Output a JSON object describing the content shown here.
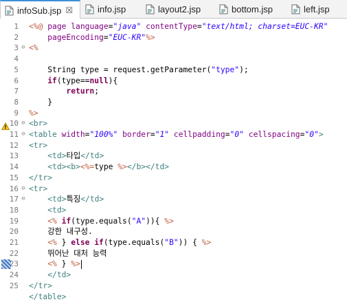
{
  "tabs": [
    {
      "label": "infoSub.jsp",
      "active": true,
      "close": "☒"
    },
    {
      "label": "info.jsp",
      "active": false
    },
    {
      "label": "layout2.jsp",
      "active": false
    },
    {
      "label": "bottom.jsp",
      "active": false
    },
    {
      "label": "left.jsp",
      "active": false
    }
  ],
  "line_numbers": [
    "1",
    "2",
    "3",
    "4",
    "5",
    "6",
    "7",
    "8",
    "9",
    "10",
    "11",
    "12",
    "13",
    "14",
    "15",
    "16",
    "17",
    "18",
    "19",
    "20",
    "21",
    "22",
    "23",
    "24",
    "25"
  ],
  "lines": [
    [
      [
        "jsp",
        "<%@ "
      ],
      [
        "attr",
        "page "
      ],
      [
        "attr",
        "language"
      ],
      [
        "plain",
        "="
      ],
      [
        "val",
        "\"java\""
      ],
      [
        "plain",
        " "
      ],
      [
        "attr",
        "contentType"
      ],
      [
        "plain",
        "="
      ],
      [
        "val",
        "\"text/html; charset=EUC-KR\""
      ]
    ],
    [
      [
        "plain",
        "    "
      ],
      [
        "attr",
        "pageEncoding"
      ],
      [
        "plain",
        "="
      ],
      [
        "val",
        "\"EUC-KR\""
      ],
      [
        "jsp",
        "%>"
      ]
    ],
    [
      [
        "jsp",
        "<%"
      ]
    ],
    [
      [
        "plain",
        ""
      ]
    ],
    [
      [
        "plain",
        "    String type = request.getParameter("
      ],
      [
        "str",
        "\"type\""
      ],
      [
        "plain",
        ");"
      ]
    ],
    [
      [
        "plain",
        "    "
      ],
      [
        "kw",
        "if"
      ],
      [
        "plain",
        "(type=="
      ],
      [
        "kw",
        "null"
      ],
      [
        "plain",
        "){"
      ]
    ],
    [
      [
        "plain",
        "        "
      ],
      [
        "kw",
        "return"
      ],
      [
        "plain",
        ";"
      ]
    ],
    [
      [
        "plain",
        "    }"
      ]
    ],
    [
      [
        "jsp",
        "%>"
      ]
    ],
    [
      [
        "tag",
        "<br>"
      ]
    ],
    [
      [
        "tag",
        "<table "
      ],
      [
        "attr",
        "width"
      ],
      [
        "plain",
        "="
      ],
      [
        "val",
        "\"100%\""
      ],
      [
        "plain",
        " "
      ],
      [
        "attr",
        "border"
      ],
      [
        "plain",
        "="
      ],
      [
        "val",
        "\"1\""
      ],
      [
        "plain",
        " "
      ],
      [
        "attr",
        "cellpadding"
      ],
      [
        "plain",
        "="
      ],
      [
        "val",
        "\"0\""
      ],
      [
        "plain",
        " "
      ],
      [
        "attr",
        "cellspacing"
      ],
      [
        "plain",
        "="
      ],
      [
        "val",
        "\"0\""
      ],
      [
        "tag",
        ">"
      ]
    ],
    [
      [
        "tag",
        "<tr>"
      ]
    ],
    [
      [
        "plain",
        "    "
      ],
      [
        "tag",
        "<td>"
      ],
      [
        "text",
        "타입"
      ],
      [
        "tag",
        "</td>"
      ]
    ],
    [
      [
        "plain",
        "    "
      ],
      [
        "tag",
        "<td><b>"
      ],
      [
        "jsp",
        "<%="
      ],
      [
        "plain",
        "type "
      ],
      [
        "jsp",
        "%>"
      ],
      [
        "tag",
        "</b></td>"
      ]
    ],
    [
      [
        "tag",
        "</tr>"
      ]
    ],
    [
      [
        "tag",
        "<tr>"
      ]
    ],
    [
      [
        "plain",
        "    "
      ],
      [
        "tag",
        "<td>"
      ],
      [
        "text",
        "특징"
      ],
      [
        "tag",
        "</td>"
      ]
    ],
    [
      [
        "plain",
        "    "
      ],
      [
        "tag",
        "<td>"
      ]
    ],
    [
      [
        "plain",
        "    "
      ],
      [
        "jsp",
        "<% "
      ],
      [
        "kw",
        "if"
      ],
      [
        "plain",
        "(type.equals("
      ],
      [
        "str",
        "\"A\""
      ],
      [
        "plain",
        ")){ "
      ],
      [
        "jsp",
        "%>"
      ]
    ],
    [
      [
        "plain",
        "    "
      ],
      [
        "text",
        "강한 내구성."
      ]
    ],
    [
      [
        "plain",
        "    "
      ],
      [
        "jsp",
        "<% "
      ],
      [
        "plain",
        "} "
      ],
      [
        "kw",
        "else if"
      ],
      [
        "plain",
        "(type.equals("
      ],
      [
        "str",
        "\"B\""
      ],
      [
        "plain",
        ")) { "
      ],
      [
        "jsp",
        "%>"
      ]
    ],
    [
      [
        "plain",
        "    "
      ],
      [
        "text",
        "뛰어난 대처 능력"
      ]
    ],
    [
      [
        "plain",
        "    "
      ],
      [
        "jsp",
        "<% "
      ],
      [
        "plain",
        "} "
      ],
      [
        "jsp",
        "%>"
      ]
    ],
    [
      [
        "plain",
        "    "
      ],
      [
        "tag",
        "</td>"
      ]
    ],
    [
      [
        "tag",
        "</tr>"
      ]
    ],
    [
      [
        "tag",
        "</table>"
      ]
    ]
  ]
}
